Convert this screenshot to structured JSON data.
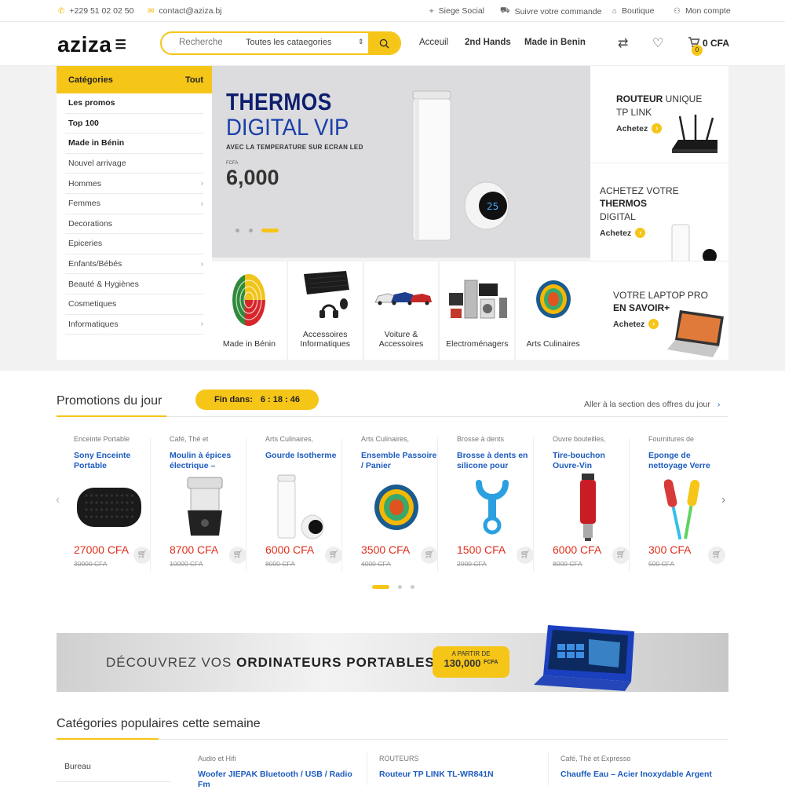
{
  "topbar": {
    "phone": "+229 51 02 02 50",
    "email": "contact@aziza.bj",
    "links": [
      "Siege Social",
      "Suivre votre commande",
      "Boutique",
      "Mon compte"
    ]
  },
  "header": {
    "logo": "aziza",
    "search_placeholder": "Recherche",
    "search_category": "Toutes les cataegories",
    "nav": [
      "Acceuil",
      "2nd Hands",
      "Made in Benin"
    ],
    "cart_count": "0",
    "cart_total": "0 CFA"
  },
  "categories": {
    "title": "Catégories",
    "all": "Tout",
    "items": [
      {
        "label": "Les promos",
        "bold": true,
        "chev": false
      },
      {
        "label": "Top 100",
        "bold": true,
        "chev": false
      },
      {
        "label": "Made in Bénin",
        "bold": true,
        "chev": false
      },
      {
        "label": "Nouvel arrivage",
        "bold": false,
        "chev": false
      },
      {
        "label": "Hommes",
        "bold": false,
        "chev": true
      },
      {
        "label": "Femmes",
        "bold": false,
        "chev": true
      },
      {
        "label": "Decorations",
        "bold": false,
        "chev": false
      },
      {
        "label": "Epiceries",
        "bold": false,
        "chev": false
      },
      {
        "label": "Enfants/Bébés",
        "bold": false,
        "chev": true
      },
      {
        "label": "Beauté & Hygiènes",
        "bold": false,
        "chev": false
      },
      {
        "label": "Cosmetiques",
        "bold": false,
        "chev": false
      },
      {
        "label": "Informatiques",
        "bold": false,
        "chev": true
      }
    ]
  },
  "slider": {
    "line1": "THERMOS",
    "line2": "DIGITAL VIP",
    "line3": "AVEC LA TEMPERATURE SUR ECRAN LED",
    "currency": "FCFA",
    "price": "6,000"
  },
  "side_ads": [
    {
      "l1a": "ROUTEUR",
      "l1b": " UNIQUE",
      "l2": "TP LINK",
      "cta": "Achetez"
    },
    {
      "l1": "ACHETEZ VOTRE",
      "l2": "THERMOS",
      "l3": "DIGITAL",
      "cta": "Achetez"
    },
    {
      "l1": "VOTRE LAPTOP PRO",
      "l2": "EN SAVOIR+",
      "cta": "Achetez"
    }
  ],
  "tiles": [
    {
      "label": "Made in Bénin"
    },
    {
      "label": "Accessoires Informatiques"
    },
    {
      "label": "Voiture & Accessoires"
    },
    {
      "label": "Electroménagers"
    },
    {
      "label": "Arts Culinaires"
    }
  ],
  "promotions": {
    "title": "Promotions du jour",
    "timer_label": "Fin dans:",
    "timer_value": "6 : 18 : 46",
    "link": "Aller à la section des offres du jour",
    "products": [
      {
        "cat": "Enceinte Portable",
        "name": "Sony Enceinte Portable",
        "price": "27000 CFA",
        "old": "30000 CFA"
      },
      {
        "cat": "Café, Thé et",
        "name": "Moulin à épices électrique –",
        "price": "8700 CFA",
        "old": "10000 CFA"
      },
      {
        "cat": "Arts Culinaires,",
        "name": "Gourde Isotherme",
        "price": "6000 CFA",
        "old": "8000 CFA"
      },
      {
        "cat": "Arts Culinaires,",
        "name": "Ensemble Passoire / Panier",
        "price": "3500 CFA",
        "old": "4000 CFA"
      },
      {
        "cat": "Brosse à dents",
        "name": "Brosse à dents en silicone pour",
        "price": "1500 CFA",
        "old": "2000 CFA"
      },
      {
        "cat": "Ouvre bouteilles,",
        "name": "Tire-bouchon Ouvre-Vin",
        "price": "6000 CFA",
        "old": "8000 CFA"
      },
      {
        "cat": "Fournitures de",
        "name": "Eponge de nettoyage Verre",
        "price": "300 CFA",
        "old": "500 CFA"
      }
    ]
  },
  "banner": {
    "text_a": "DÉCOUVREZ VOS ",
    "text_b": "ORDINATEURS PORTABLES",
    "badge_small": "A PARTIR DE",
    "badge_value": "130,000",
    "badge_currency": "FCFA"
  },
  "popular": {
    "title": "Catégories populaires cette semaine",
    "side_item": "Bureau",
    "items": [
      {
        "cat": "Audio et Hifi",
        "name": "Woofer JIEPAK Bluetooth / USB / Radio Fm"
      },
      {
        "cat": "ROUTEURS",
        "name": "Routeur TP LINK TL-WR841N"
      },
      {
        "cat": "Café, Thé et Expresso",
        "name": "Chauffe Eau – Acier Inoxydable Argent"
      }
    ]
  },
  "colors": {
    "accent": "#f5c518",
    "link": "#1c5bbf",
    "price": "#e0301e"
  }
}
